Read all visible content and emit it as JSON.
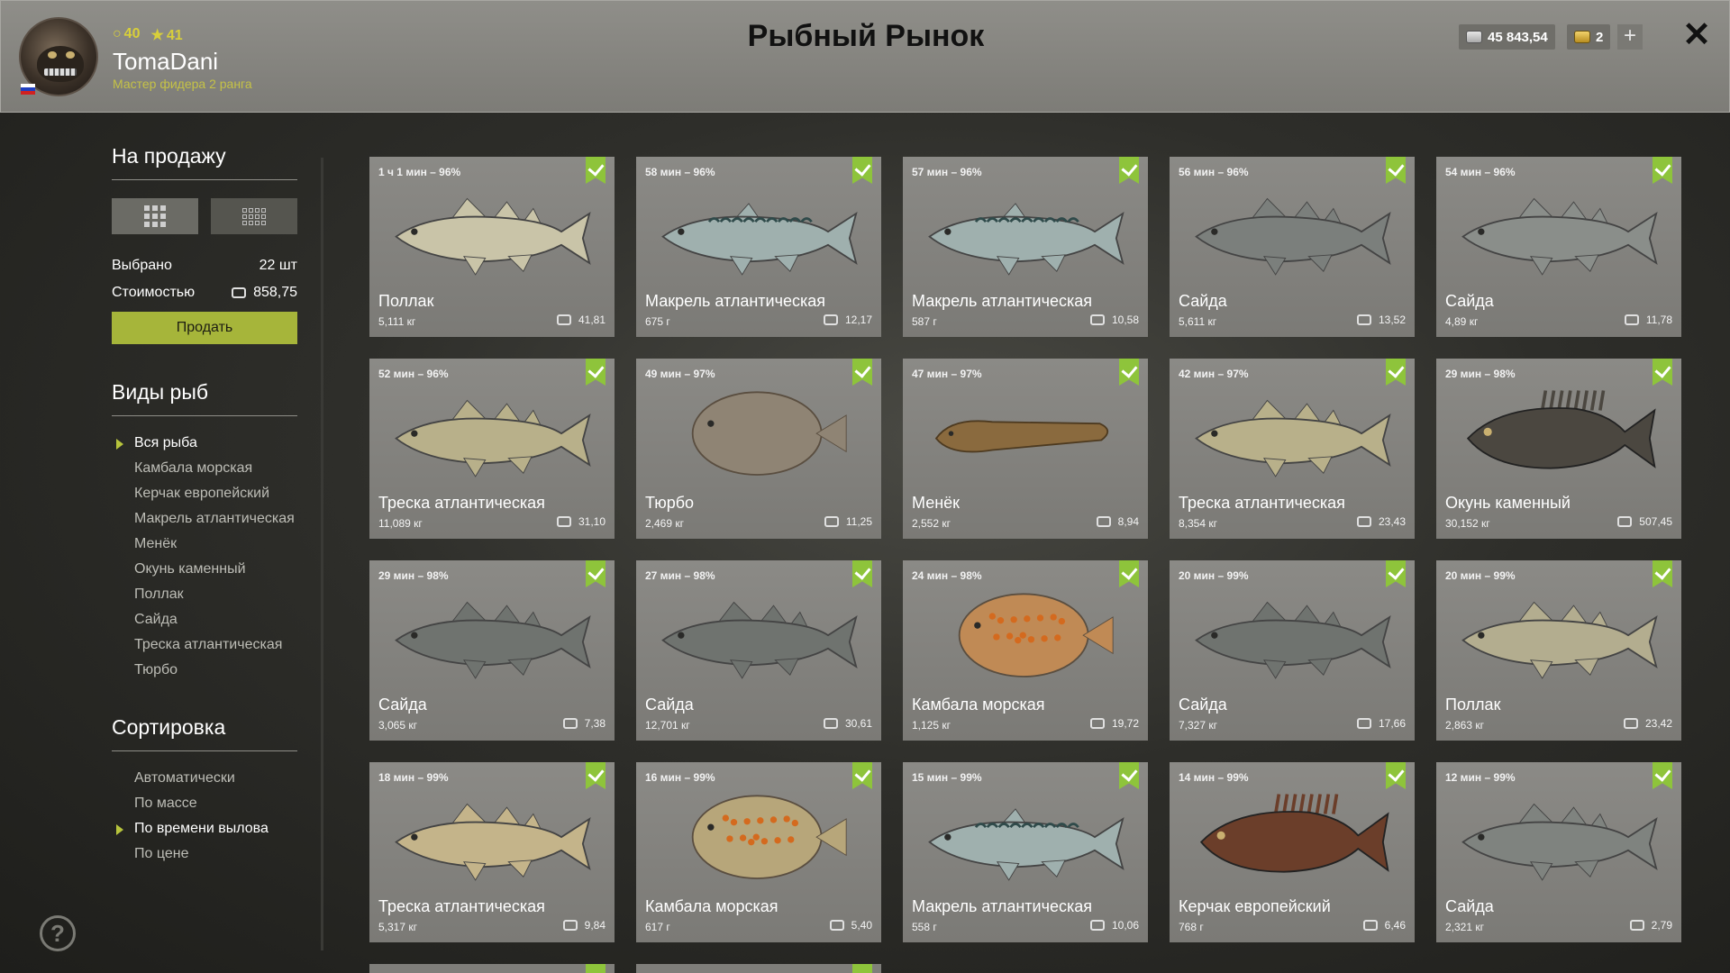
{
  "header": {
    "title": "Рыбный Рынок",
    "level_a": "40",
    "level_b": "41",
    "username": "TomaDani",
    "rank": "Мастер фидера 2 ранга",
    "silver": "45 843,54",
    "gold": "2",
    "plus": "+",
    "close": "✕"
  },
  "sidebar": {
    "for_sale_title": "На продажу",
    "selected_label": "Выбрано",
    "selected_value": "22 шт",
    "cost_label": "Стоимостью",
    "cost_value": "858,75",
    "sell_label": "Продать",
    "species_title": "Виды рыб",
    "species": [
      "Вся рыба",
      "Камбала морская",
      "Керчак европейский",
      "Макрель атлантическая",
      "Менёк",
      "Окунь каменный",
      "Поллак",
      "Сайда",
      "Треска атлантическая",
      "Тюрбо"
    ],
    "sort_title": "Сортировка",
    "sort": [
      "Автоматически",
      "По массе",
      "По времени вылова",
      "По цене"
    ],
    "help": "?"
  },
  "colors": {
    "accent": "#a6b53a",
    "check": "#8ec43b",
    "header_bg": "#8f8e89"
  },
  "fish": [
    {
      "meta": "1 ч 1 мин – 96%",
      "name": "Поллак",
      "weight": "5,111 кг",
      "price": "41,81",
      "kind": "slim",
      "color": "#c9c4a8"
    },
    {
      "meta": "58 мин – 96%",
      "name": "Макрель атлантическая",
      "weight": "675 г",
      "price": "12,17",
      "kind": "mackerel",
      "color": "#9fb0ae"
    },
    {
      "meta": "57 мин – 96%",
      "name": "Макрель атлантическая",
      "weight": "587 г",
      "price": "10,58",
      "kind": "mackerel",
      "color": "#9fb0ae"
    },
    {
      "meta": "56 мин – 96%",
      "name": "Сайда",
      "weight": "5,611 кг",
      "price": "13,52",
      "kind": "slim",
      "color": "#7b7f7c"
    },
    {
      "meta": "54 мин – 96%",
      "name": "Сайда",
      "weight": "4,89 кг",
      "price": "11,78",
      "kind": "slim",
      "color": "#8a8e8a"
    },
    {
      "meta": "52 мин – 96%",
      "name": "Треска атлантическая",
      "weight": "11,089 кг",
      "price": "31,10",
      "kind": "cod",
      "color": "#b8b08a"
    },
    {
      "meta": "49 мин – 97%",
      "name": "Тюрбо",
      "weight": "2,469 кг",
      "price": "11,25",
      "kind": "flat",
      "color": "#8f8474"
    },
    {
      "meta": "47 мин – 97%",
      "name": "Менёк",
      "weight": "2,552 кг",
      "price": "8,94",
      "kind": "eel",
      "color": "#8a6a3e"
    },
    {
      "meta": "42 мин – 97%",
      "name": "Треска атлантическая",
      "weight": "8,354 кг",
      "price": "23,43",
      "kind": "cod",
      "color": "#b8b08a"
    },
    {
      "meta": "29 мин – 98%",
      "name": "Окунь каменный",
      "weight": "30,152 кг",
      "price": "507,45",
      "kind": "bass",
      "color": "#4b4740"
    },
    {
      "meta": "29 мин – 98%",
      "name": "Сайда",
      "weight": "3,065 кг",
      "price": "7,38",
      "kind": "slim",
      "color": "#6f736f"
    },
    {
      "meta": "27 мин – 98%",
      "name": "Сайда",
      "weight": "12,701 кг",
      "price": "30,61",
      "kind": "slim",
      "color": "#6f736f"
    },
    {
      "meta": "24 мин – 98%",
      "name": "Камбала морская",
      "weight": "1,125 кг",
      "price": "19,72",
      "kind": "plaice",
      "color": "#c08a55"
    },
    {
      "meta": "20 мин – 99%",
      "name": "Сайда",
      "weight": "7,327 кг",
      "price": "17,66",
      "kind": "slim",
      "color": "#6f736f"
    },
    {
      "meta": "20 мин – 99%",
      "name": "Поллак",
      "weight": "2,863 кг",
      "price": "23,42",
      "kind": "slim",
      "color": "#b3ad8f"
    },
    {
      "meta": "18 мин – 99%",
      "name": "Треска атлантическая",
      "weight": "5,317 кг",
      "price": "9,84",
      "kind": "cod",
      "color": "#c4b48a"
    },
    {
      "meta": "16 мин – 99%",
      "name": "Камбала морская",
      "weight": "617 г",
      "price": "5,40",
      "kind": "plaice",
      "color": "#b7a67a"
    },
    {
      "meta": "15 мин – 99%",
      "name": "Макрель атлантическая",
      "weight": "558 г",
      "price": "10,06",
      "kind": "mackerel",
      "color": "#9fb0ae"
    },
    {
      "meta": "14 мин – 99%",
      "name": "Керчак европейский",
      "weight": "768 г",
      "price": "6,46",
      "kind": "sculpin",
      "color": "#6b3e2a"
    },
    {
      "meta": "12 мин – 99%",
      "name": "Сайда",
      "weight": "2,321 кг",
      "price": "2,79",
      "kind": "slim",
      "color": "#7f837f"
    }
  ]
}
